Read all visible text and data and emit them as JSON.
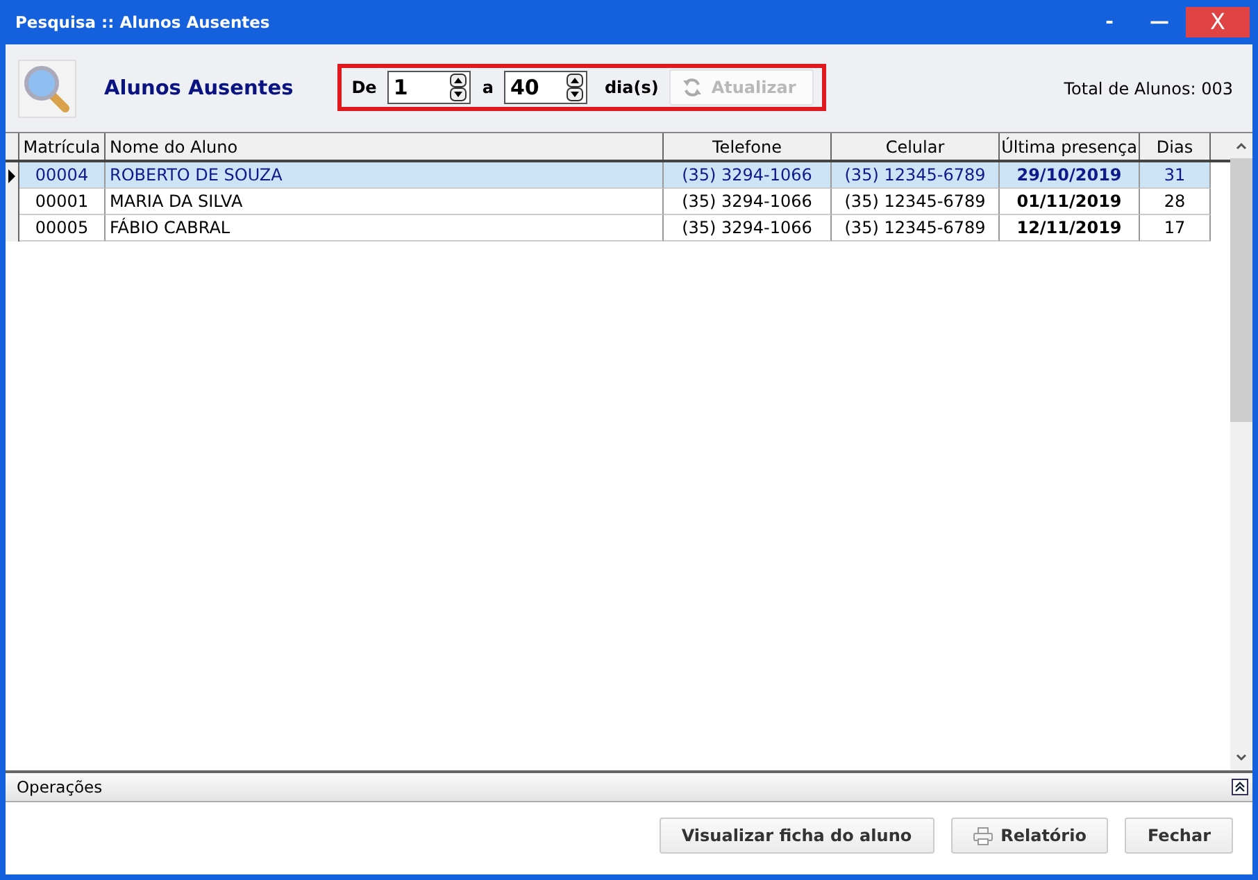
{
  "window": {
    "title": "Pesquisa :: Alunos Ausentes",
    "controls": [
      "-",
      "—",
      "X"
    ]
  },
  "header": {
    "title": "Alunos Ausentes",
    "from_label": "De",
    "from_value": "1",
    "to_label": "a",
    "to_value": "40",
    "unit": "dia(s)",
    "refresh": {
      "label": "Atualizar",
      "disabled": true
    },
    "total": "Total de Alunos: 003"
  },
  "table": {
    "columns": [
      "Matrícula",
      "Nome do Aluno",
      "Telefone",
      "Celular",
      "Última presença",
      "Dias"
    ],
    "rows": [
      {
        "selected": true,
        "cells": [
          "00004",
          "ROBERTO DE SOUZA",
          "(35) 3294-1066",
          "(35) 12345-6789",
          "29/10/2019",
          "31"
        ]
      },
      {
        "selected": false,
        "cells": [
          "00001",
          "MARIA DA SILVA",
          "(35) 3294-1066",
          "(35) 12345-6789",
          "01/11/2019",
          "28"
        ]
      },
      {
        "selected": false,
        "cells": [
          "00005",
          "FÁBIO CABRAL",
          "(35) 3294-1066",
          "(35) 12345-6789",
          "12/11/2019",
          "17"
        ]
      }
    ]
  },
  "operations": {
    "title": "Operações",
    "expanded": true
  },
  "buttons": [
    {
      "label": "Visualizar ficha do aluno",
      "kind": "plain"
    },
    {
      "label": "Relatório",
      "kind": "print"
    },
    {
      "label": "Fechar",
      "kind": "plain"
    }
  ]
}
